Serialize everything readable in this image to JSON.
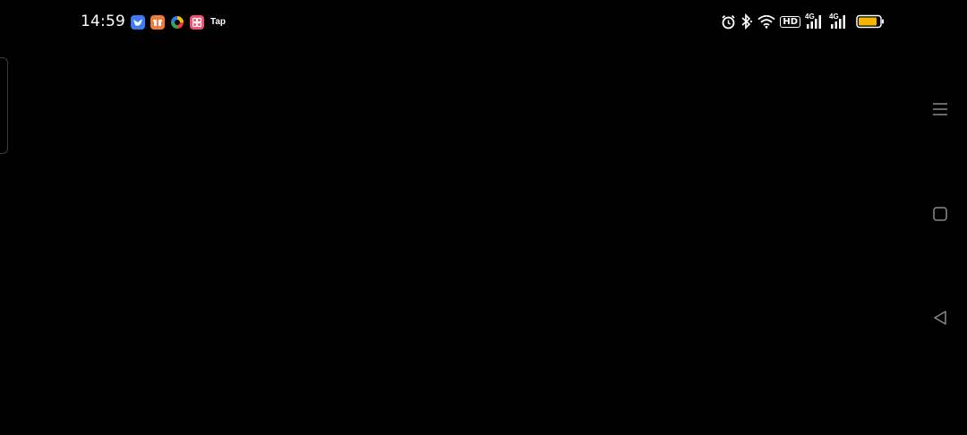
{
  "status_bar": {
    "time": "14:59",
    "notification_apps": [
      {
        "icon": "bird-app-icon",
        "color": "#3d7cf0"
      },
      {
        "icon": "gift-box-app-icon",
        "color": "#f07a3a"
      },
      {
        "icon": "colorful-ring-app-icon",
        "color": "#ffffff"
      },
      {
        "icon": "square-grid-app-icon",
        "color": "#f0506e"
      }
    ],
    "tap_label": "Tap",
    "system_icons": [
      "alarm-icon",
      "bluetooth-icon",
      "wifi-icon",
      "hd-icon",
      "signal-4g-icon",
      "signal-4g-icon"
    ],
    "network_type_1": "4G",
    "network_type_2": "4G",
    "hd_label": "HD",
    "battery_color": "#f5b800"
  },
  "navigation": {
    "buttons": [
      "menu",
      "home",
      "back"
    ]
  },
  "colors": {
    "background": "#000000",
    "nav_icon": "#8a8a8a",
    "edge_handle": "#3c3c3c"
  }
}
